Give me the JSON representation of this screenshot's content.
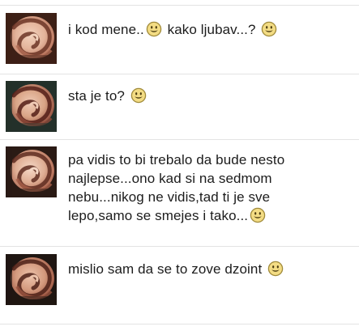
{
  "messages": [
    {
      "lines": [
        [
          {
            "type": "text",
            "value": "i kod mene.."
          },
          {
            "type": "icon",
            "value": "smiley-icon"
          },
          {
            "type": "text",
            "value": " kako ljubav...? "
          },
          {
            "type": "icon",
            "value": "smiley-icon"
          }
        ]
      ]
    },
    {
      "lines": [
        [
          {
            "type": "text",
            "value": "sta je to? "
          },
          {
            "type": "icon",
            "value": "smiley-icon"
          }
        ]
      ]
    },
    {
      "lines": [
        [
          {
            "type": "text",
            "value": "pa vidis to bi trebalo da bude nesto"
          }
        ],
        [
          {
            "type": "text",
            "value": "najlepse...ono kad si na sedmom"
          }
        ],
        [
          {
            "type": "text",
            "value": "nebu...nikog ne vidis,tad ti je sve"
          }
        ],
        [
          {
            "type": "text",
            "value": "lepo,samo se smejes i tako..."
          },
          {
            "type": "icon",
            "value": "smiley-icon"
          }
        ]
      ]
    },
    {
      "lines": [
        [
          {
            "type": "text",
            "value": "mislio sam da se to zove dzoint "
          },
          {
            "type": "icon",
            "value": "smiley-icon"
          }
        ]
      ]
    }
  ],
  "colors": {
    "text": "#1c1c1c",
    "divider": "#e3e3e3",
    "smiley_fill": "#f3dc84",
    "smiley_stroke": "#a08a3a"
  }
}
